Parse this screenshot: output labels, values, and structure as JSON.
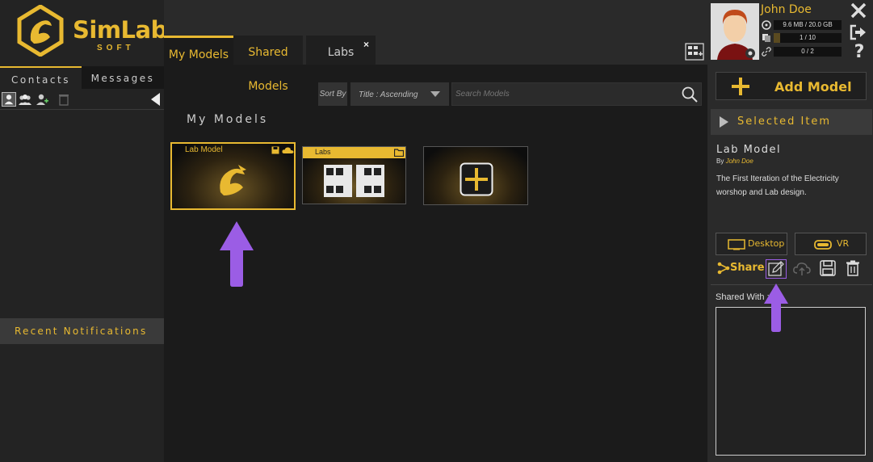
{
  "brand": {
    "name": "SimLab",
    "sub": "SOFT",
    "accent": "#e8b931",
    "highlight": "#9b5de5"
  },
  "left": {
    "tabs": [
      {
        "label": "Contacts"
      },
      {
        "label": "Messages"
      }
    ],
    "recent_label": "Recent Notifications"
  },
  "center": {
    "tabs": [
      {
        "label": "My Models"
      },
      {
        "label": "Shared Models"
      },
      {
        "label": "Labs"
      }
    ],
    "tab_close": "×",
    "sort_by": "Sort By",
    "sort_value": "Title : Ascending",
    "search_placeholder": "Search Models",
    "section_title": "My Models",
    "cards": [
      {
        "title": "Lab Model"
      },
      {
        "title": "Labs"
      }
    ]
  },
  "right": {
    "user_name": "John Doe",
    "stats": [
      "9.6 MB / 20.0 GB",
      "1 / 10",
      "0 / 2"
    ],
    "help_glyph": "?",
    "add_model_label": "Add Model",
    "selected_header": "Selected Item",
    "item_title": "Lab Model",
    "item_by_prefix": "By",
    "item_author": "John Doe",
    "item_description": "The First Iteration of the Electricity worshop and Lab design.",
    "desktop_label": "Desktop",
    "vr_label": "VR",
    "share_label": "Share",
    "shared_with_label": "Shared With :"
  }
}
